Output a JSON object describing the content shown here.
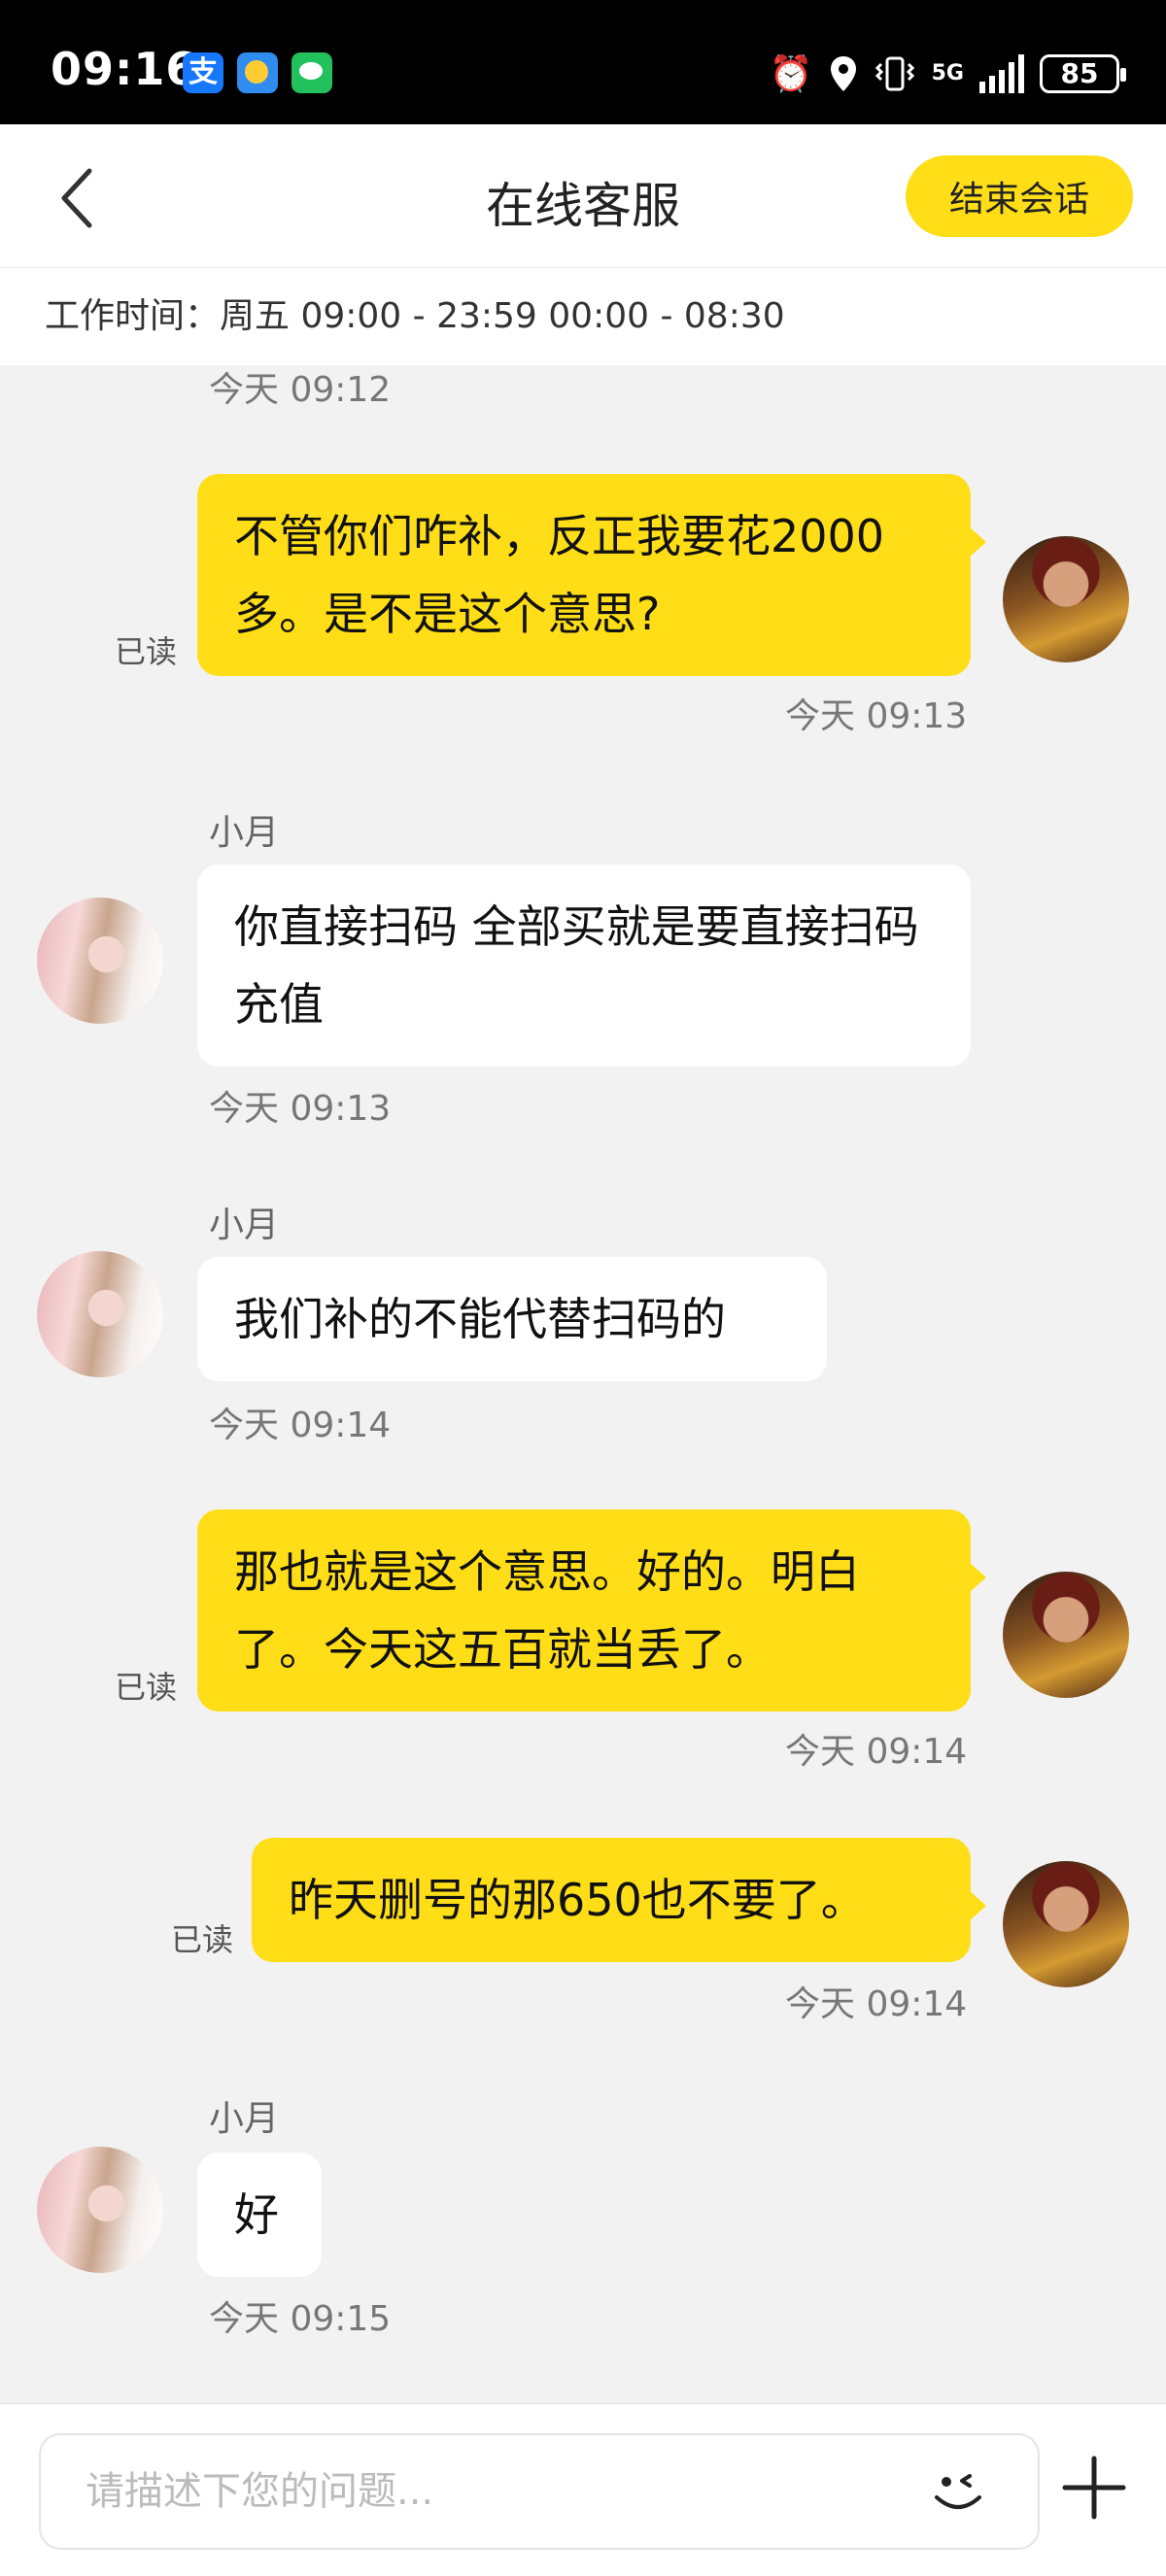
{
  "status_bar": {
    "time": "09:16",
    "alipay_glyph": "支",
    "network": "5G",
    "battery": "85",
    "icons": [
      "alipay-icon",
      "weather-icon",
      "wechat-icon",
      "alarm-icon",
      "location-icon",
      "vibrate-icon",
      "signal-icon",
      "battery-icon"
    ]
  },
  "header": {
    "title": "在线客服",
    "end_button": "结束会话"
  },
  "work_hours": "工作时间：周五 09:00 - 23:59 00:00 - 08:30",
  "messages": [
    {
      "type": "time",
      "text": "今天 09:12"
    },
    {
      "type": "outgoing",
      "text": "不管你们咋补，反正我要花2000多。是不是这个意思?",
      "status": "已读",
      "time": "今天 09:13"
    },
    {
      "type": "incoming",
      "sender": "小月",
      "text": "你直接扫码 全部买就是要直接扫码充值",
      "time": "今天 09:13"
    },
    {
      "type": "incoming",
      "sender": "小月",
      "text": "我们补的不能代替扫码的",
      "time": "今天 09:14"
    },
    {
      "type": "outgoing",
      "text": "那也就是这个意思。好的。明白了。今天这五百就当丢了。",
      "status": "已读",
      "time": "今天 09:14"
    },
    {
      "type": "outgoing",
      "text": "昨天删号的那650也不要了。",
      "status": "已读",
      "time": "今天 09:14"
    },
    {
      "type": "incoming",
      "sender": "小月",
      "text": "好",
      "time": "今天 09:15"
    }
  ],
  "input": {
    "placeholder": "请描述下您的问题..."
  },
  "colors": {
    "accent": "#ffde17",
    "background": "#f2f2f2",
    "incoming_bubble": "#ffffff"
  }
}
